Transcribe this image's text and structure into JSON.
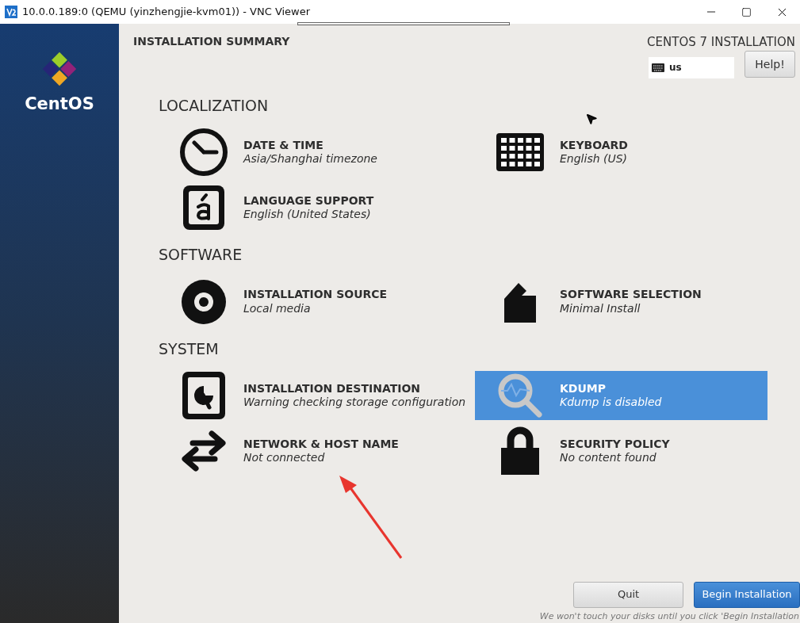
{
  "window": {
    "title": "10.0.0.189:0 (QEMU (yinzhengjie-kvm01)) - VNC Viewer"
  },
  "sidebar": {
    "logo_text": "CentOS"
  },
  "header": {
    "title": "INSTALLATION SUMMARY",
    "product": "CENTOS 7 INSTALLATION",
    "keyboard_layout": "us",
    "help_button": "Help!"
  },
  "sections": [
    {
      "title": "LOCALIZATION",
      "items": [
        {
          "kind": "clock",
          "title": "DATE & TIME",
          "status": "Asia/Shanghai timezone",
          "selected": false
        },
        {
          "kind": "keyboard",
          "title": "KEYBOARD",
          "status": "English (US)",
          "selected": false
        },
        {
          "kind": "language",
          "title": "LANGUAGE SUPPORT",
          "status": "English (United States)",
          "selected": false
        }
      ]
    },
    {
      "title": "SOFTWARE",
      "items": [
        {
          "kind": "disc",
          "title": "INSTALLATION SOURCE",
          "status": "Local media",
          "selected": false
        },
        {
          "kind": "package",
          "title": "SOFTWARE SELECTION",
          "status": "Minimal Install",
          "selected": false
        }
      ]
    },
    {
      "title": "SYSTEM",
      "items": [
        {
          "kind": "disk",
          "title": "INSTALLATION DESTINATION",
          "status": "Warning checking storage configuration",
          "selected": false
        },
        {
          "kind": "search",
          "title": "KDUMP",
          "status": "Kdump is disabled",
          "selected": true
        },
        {
          "kind": "network",
          "title": "NETWORK & HOST NAME",
          "status": "Not connected",
          "selected": false
        },
        {
          "kind": "lock",
          "title": "SECURITY POLICY",
          "status": "No content found",
          "selected": false
        }
      ]
    }
  ],
  "buttons": [
    {
      "kind": "secondary",
      "label": "Quit"
    },
    {
      "kind": "primary",
      "label": "Begin Installation"
    }
  ],
  "footer_note": "We won't touch your disks until you click 'Begin Installation"
}
